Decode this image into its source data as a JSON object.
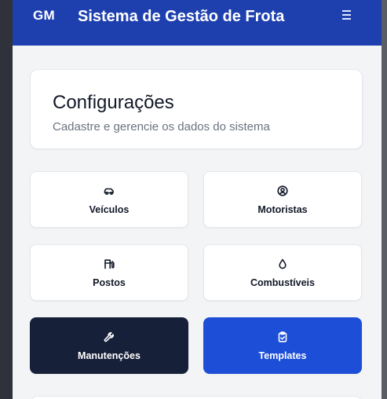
{
  "header": {
    "logo": "GM",
    "title": "Sistema de Gestão de Frota",
    "menu_icon": "hamburger-menu-icon"
  },
  "page": {
    "title": "Configurações",
    "subtitle": "Cadastre e gerencie os dados do sistema"
  },
  "tiles": [
    {
      "label": "Veículos",
      "icon": "car-icon"
    },
    {
      "label": "Motoristas",
      "icon": "user-circle-icon"
    },
    {
      "label": "Postos",
      "icon": "fuel-pump-icon"
    },
    {
      "label": "Combustíveis",
      "icon": "droplet-icon"
    },
    {
      "label": "Manutenções",
      "icon": "wrench-icon"
    },
    {
      "label": "Templates",
      "icon": "clipboard-check-icon"
    }
  ],
  "colors": {
    "header_bg": "#1e40af",
    "dark_tile": "#172039",
    "accent_tile": "#1d4ed8",
    "page_bg": "#f3f4f6"
  }
}
